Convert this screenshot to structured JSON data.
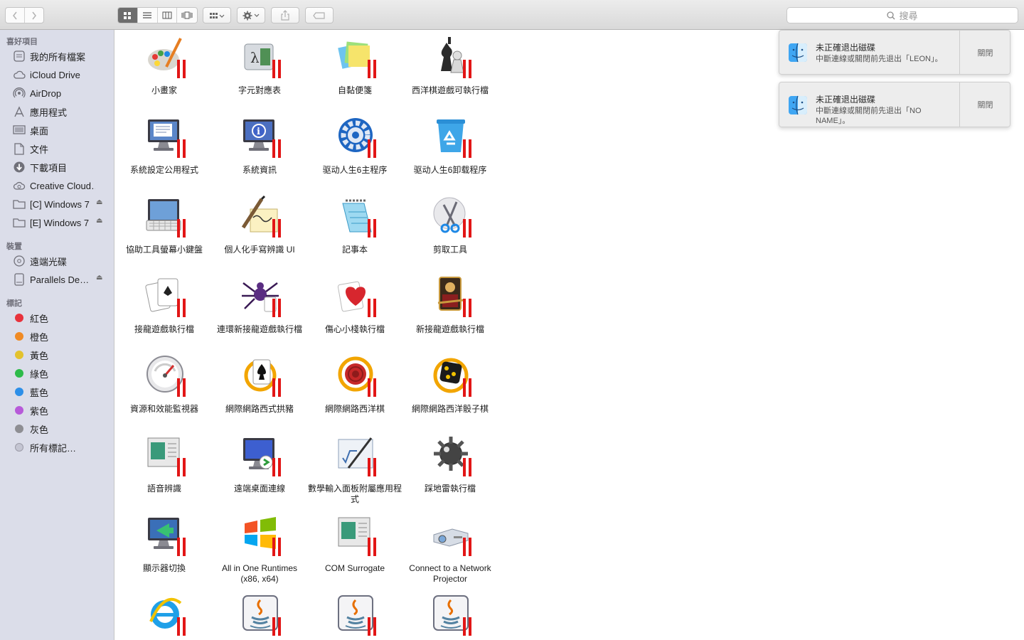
{
  "toolbar": {
    "search_placeholder": "搜尋"
  },
  "sidebar": {
    "favorites_header": "喜好項目",
    "favorites": [
      {
        "label": "我的所有檔案",
        "icon": "all-files-icon"
      },
      {
        "label": "iCloud Drive",
        "icon": "cloud-icon"
      },
      {
        "label": "AirDrop",
        "icon": "airdrop-icon"
      },
      {
        "label": "應用程式",
        "icon": "applications-icon"
      },
      {
        "label": "桌面",
        "icon": "desktop-icon"
      },
      {
        "label": "文件",
        "icon": "document-icon"
      },
      {
        "label": "下載項目",
        "icon": "download-icon"
      },
      {
        "label": "Creative Cloud…",
        "icon": "creative-cloud-icon"
      },
      {
        "label": "[C] Windows 7",
        "icon": "folder-icon",
        "eject": true
      },
      {
        "label": "[E] Windows 7",
        "icon": "folder-icon",
        "eject": true
      }
    ],
    "devices_header": "裝置",
    "devices": [
      {
        "label": "遠端光碟",
        "icon": "optical-disc-icon"
      },
      {
        "label": "Parallels De…",
        "icon": "drive-icon",
        "eject": true
      }
    ],
    "tags_header": "標記",
    "tags": [
      {
        "label": "紅色",
        "color": "#e8323c"
      },
      {
        "label": "橙色",
        "color": "#f08a24"
      },
      {
        "label": "黃色",
        "color": "#e3c22d"
      },
      {
        "label": "綠色",
        "color": "#2ebb4a"
      },
      {
        "label": "藍色",
        "color": "#2d8fe8"
      },
      {
        "label": "紫色",
        "color": "#b75ad9"
      },
      {
        "label": "灰色",
        "color": "#8e8e93"
      },
      {
        "label": "所有標記…",
        "color": ""
      }
    ]
  },
  "files": [
    {
      "label": "小畫家",
      "icon": "paint-icon"
    },
    {
      "label": "字元對應表",
      "icon": "character-map-icon"
    },
    {
      "label": "自黏便箋",
      "icon": "sticky-notes-icon"
    },
    {
      "label": "西洋棋遊戲可執行檔",
      "icon": "chess-icon"
    },
    {
      "label": "系統設定公用程式",
      "icon": "system-config-icon"
    },
    {
      "label": "系統資訊",
      "icon": "system-info-icon"
    },
    {
      "label": "驱动人生6主程序",
      "icon": "gear-icon"
    },
    {
      "label": "驱动人生6卸载程序",
      "icon": "recycle-bin-icon"
    },
    {
      "label": "協助工具螢幕小鍵盤",
      "icon": "keyboard-icon"
    },
    {
      "label": "個人化手寫辨識 UI",
      "icon": "handwriting-icon"
    },
    {
      "label": "記事本",
      "icon": "notepad-icon"
    },
    {
      "label": "剪取工具",
      "icon": "scissors-icon"
    },
    {
      "label": "接龍遊戲執行檔",
      "icon": "solitaire-icon"
    },
    {
      "label": "連環新接龍遊戲執行檔",
      "icon": "spider-icon"
    },
    {
      "label": "傷心小棧執行檔",
      "icon": "hearts-icon"
    },
    {
      "label": "新接龍遊戲執行檔",
      "icon": "freecell-icon"
    },
    {
      "label": "資源和效能監視器",
      "icon": "gauge-icon"
    },
    {
      "label": "網際網路西式拱豬",
      "icon": "internet-spades-icon"
    },
    {
      "label": "網際網路西洋棋",
      "icon": "internet-checkers-icon"
    },
    {
      "label": "網際網路西洋骰子棋",
      "icon": "internet-backgammon-icon"
    },
    {
      "label": "語音辨識",
      "icon": "speech-icon"
    },
    {
      "label": "遠端桌面連線",
      "icon": "remote-desktop-icon"
    },
    {
      "label": "數學輸入面板附屬應用程式",
      "icon": "math-input-icon"
    },
    {
      "label": "踩地雷執行檔",
      "icon": "minesweeper-icon"
    },
    {
      "label": "顯示器切換",
      "icon": "display-switch-icon"
    },
    {
      "label": "All in One Runtimes (x86, x64)",
      "icon": "windows-flag-icon"
    },
    {
      "label": "COM Surrogate",
      "icon": "com-surrogate-icon"
    },
    {
      "label": "Connect to a Network Projector",
      "icon": "projector-icon"
    },
    {
      "label": "",
      "icon": "internet-explorer-icon"
    },
    {
      "label": "",
      "icon": "java-icon"
    },
    {
      "label": "",
      "icon": "java-icon"
    },
    {
      "label": "",
      "icon": "java-icon"
    }
  ],
  "notifications": [
    {
      "title": "未正確退出磁碟",
      "body": "中斷連線或關閉前先退出「LEON」。",
      "button": "關閉"
    },
    {
      "title": "未正確退出磁碟",
      "body": "中斷連線或關閉前先退出「NO NAME」。",
      "button": "關閉"
    }
  ]
}
